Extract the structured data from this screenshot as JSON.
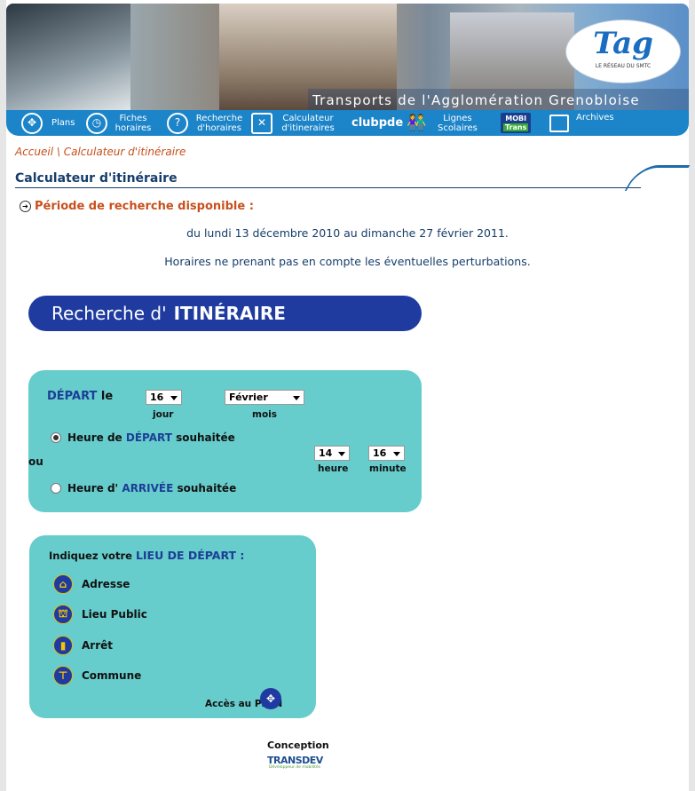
{
  "banner": {
    "title": "Transports de l'Agglomération Grenobloise",
    "logo_text": "Tag",
    "logo_sub": "LE RÉSEAU DU SMTC"
  },
  "nav": {
    "items": [
      {
        "label": "Plans",
        "icon": "compass-icon"
      },
      {
        "label": "Fiches horaires",
        "icon": "clock-icon"
      },
      {
        "label": "Recherche d'horaires",
        "icon": "question-clock-icon"
      },
      {
        "label": "Calculateur d'itineraires",
        "icon": "arrows-icon"
      },
      {
        "label": "clubpde",
        "icon": "clubpde-logo"
      },
      {
        "label": "Lignes Scolaires",
        "icon": "children-icon"
      },
      {
        "label": "MOBI Trans",
        "icon": "mobitrans-logo"
      },
      {
        "label": "Archives",
        "icon": "folder-icon"
      }
    ]
  },
  "breadcrumb": "Accueil \\ Calculateur d'itinéraire",
  "section_title": "Calculateur d'itinéraire",
  "period": {
    "heading": "Période de recherche disponible :",
    "dates": "du lundi 13 décembre 2010 au dimanche 27 février 2011.",
    "notice": "Horaires ne prenant pas en compte les éventuelles perturbations."
  },
  "search_banner": {
    "part1": "Recherche d'",
    "part2": "ITINÉRAIRE"
  },
  "departure": {
    "label_highlight": "DÉPART",
    "label_suffix": " le",
    "day_value": "16",
    "day_caption": "jour",
    "month_value": "Février",
    "month_caption": "mois",
    "option1_prefix": "Heure de ",
    "option1_highlight": "DÉPART",
    "option1_suffix": " souhaitée",
    "or_label": "ou",
    "option2_prefix": "Heure d' ",
    "option2_highlight": "ARRIVÉE",
    "option2_suffix": " souhaitée",
    "hour_value": "14",
    "hour_caption": "heure",
    "minute_value": "16",
    "minute_caption": "minute"
  },
  "place": {
    "heading_prefix": "Indiquez votre ",
    "heading_highlight": "LIEU DE DÉPART :",
    "options": [
      "Adresse",
      "Lieu Public",
      "Arrêt",
      "Commune"
    ],
    "plan_link": "Accès au PLAN"
  },
  "footer": {
    "conception": "Conception",
    "brand": "TRANSDEV",
    "brand_sub": "Développeur de mobilités"
  }
}
